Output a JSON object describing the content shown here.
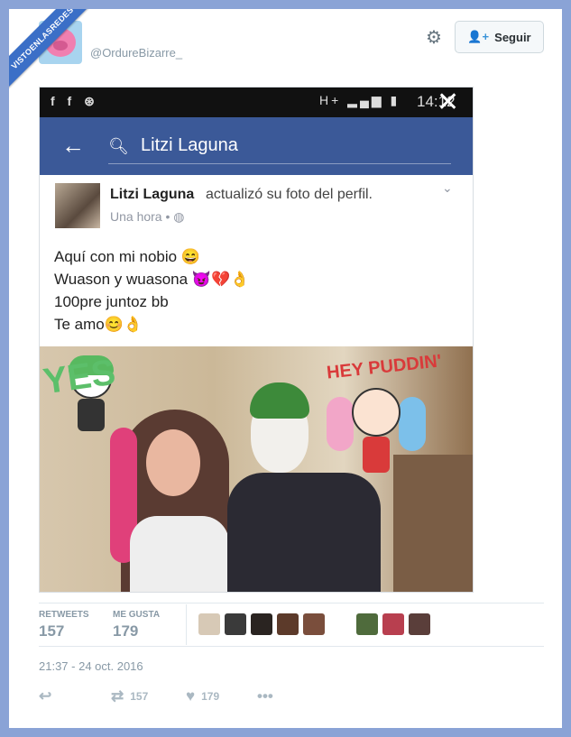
{
  "watermark": "VISTOENLASREDES",
  "user": {
    "handle": "@OrdureBizarre_"
  },
  "follow_button": {
    "label": "Seguir"
  },
  "phone": {
    "status_time": "14:12",
    "status_left": "f f ⊛",
    "status_right": "H+",
    "search_query": "Litzi Laguna"
  },
  "post": {
    "name": "Litzi Laguna",
    "action": "actualizó su foto del perfil.",
    "time": "Una hora •",
    "lines": [
      "Aquí con mi nobio 😄",
      "Wuason y wuasona 😈💔👌",
      "100pre juntoz bb",
      "Te amo😊👌"
    ],
    "sticker_left": "YES",
    "sticker_right": "HEY PUDDIN'"
  },
  "stats": {
    "retweets_label": "RETWEETS",
    "retweets": "157",
    "likes_label": "ME GUSTA",
    "likes": "179"
  },
  "liker_colors": [
    "#d7c9b6",
    "#3a3a3a",
    "#2a2421",
    "#5c3a2a",
    "#7a4e3c",
    "#4f6b3c",
    "#b83f4f",
    "#5a3e3a"
  ],
  "timestamp": "21:37 - 24 oct. 2016",
  "actions": {
    "retweet_count": "157",
    "like_count": "179"
  }
}
